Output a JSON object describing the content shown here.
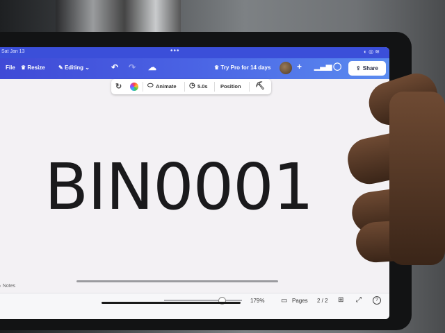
{
  "status_bar": {
    "date": "Sat Jan 13",
    "dots": "•••",
    "system_icons": "◐ ◎ ≋"
  },
  "topbar": {
    "file_label": "File",
    "resize_label": "Resize",
    "editing_label": "Editing",
    "editing_icon": "pencil-icon",
    "try_pro_label": "Try Pro for 14 days",
    "share_label": "Share"
  },
  "context_toolbar": {
    "animate_label": "Animate",
    "duration_label": "5.0s",
    "position_label": "Position"
  },
  "canvas": {
    "text": "BIN0001"
  },
  "bottom_bar": {
    "notes_label": "Notes",
    "zoom_level": "179%",
    "pages_label": "Pages",
    "page_indicator": "2 / 2"
  },
  "colors": {
    "topbar_left": "#3f49d6",
    "topbar_right": "#5b8cf0",
    "canvas_bg": "#f3f1f4",
    "text": "#1a1a1c"
  }
}
